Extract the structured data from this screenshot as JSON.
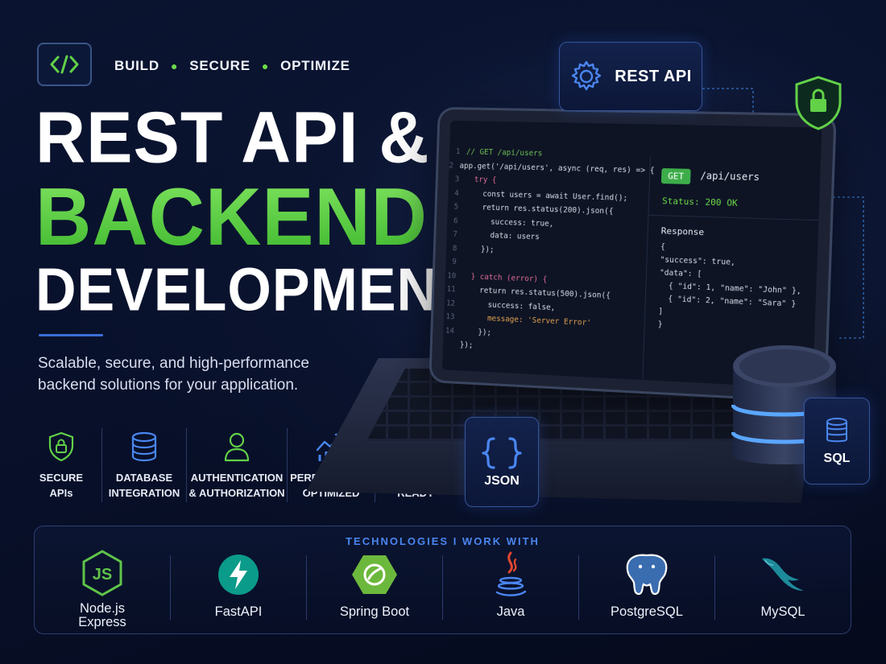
{
  "header": {
    "tagline": [
      "BUILD",
      "SECURE",
      "OPTIMIZE"
    ]
  },
  "headline": {
    "line1": "REST API &",
    "line2": "BACKEND",
    "line3": "DEVELOPMENT"
  },
  "subtitle": "Scalable, secure, and high-performance backend solutions for your application.",
  "features": [
    {
      "label": "SECURE\nAPIs",
      "icon": "shield-lock-icon"
    },
    {
      "label": "DATABASE\nINTEGRATION",
      "icon": "database-icon"
    },
    {
      "label": "AUTHENTICATION\n& AUTHORIZATION",
      "icon": "user-icon"
    },
    {
      "label": "PERFORMANCE\nOPTIMIZED",
      "icon": "chart-trend-icon"
    },
    {
      "label": "DEPLOYMENT\nREADY",
      "icon": "cloud-download-icon"
    }
  ],
  "tech": {
    "title": "TECHNOLOGIES I WORK WITH",
    "items": [
      {
        "label": "Node.js\nExpress",
        "icon": "nodejs-icon"
      },
      {
        "label": "FastAPI",
        "icon": "fastapi-icon"
      },
      {
        "label": "Spring Boot",
        "icon": "spring-boot-icon"
      },
      {
        "label": "Java",
        "icon": "java-icon"
      },
      {
        "label": "PostgreSQL",
        "icon": "postgresql-icon"
      },
      {
        "label": "MySQL",
        "icon": "mysql-icon"
      }
    ]
  },
  "illustration": {
    "rest_api_card": "REST API",
    "json_card": "JSON",
    "sql_card": "SQL",
    "code_lines": [
      "// GET /api/users",
      "app.get('/api/users', async (req, res) => {",
      "  try {",
      "    const users = await User.find();",
      "    return res.status(200).json({",
      "      success: true,",
      "      data: users",
      "    });",
      "",
      "  } catch (error) {",
      "    return res.status(500).json({",
      "      success: false,",
      "      message: 'Server Error'",
      "    });",
      "});"
    ],
    "request": {
      "method": "GET",
      "path": "/api/users",
      "status": "Status: 200 OK"
    },
    "response_label": "Response",
    "response_json": "{\n\"success\": true,\n\"data\": [\n  { \"id\": 1, \"name\": \"John\" },\n  { \"id\": 2, \"name\": \"Sara\" }\n]\n}"
  },
  "colors": {
    "accent_green": "#62d148",
    "accent_blue": "#3b6fd8",
    "background": "#08102a"
  }
}
